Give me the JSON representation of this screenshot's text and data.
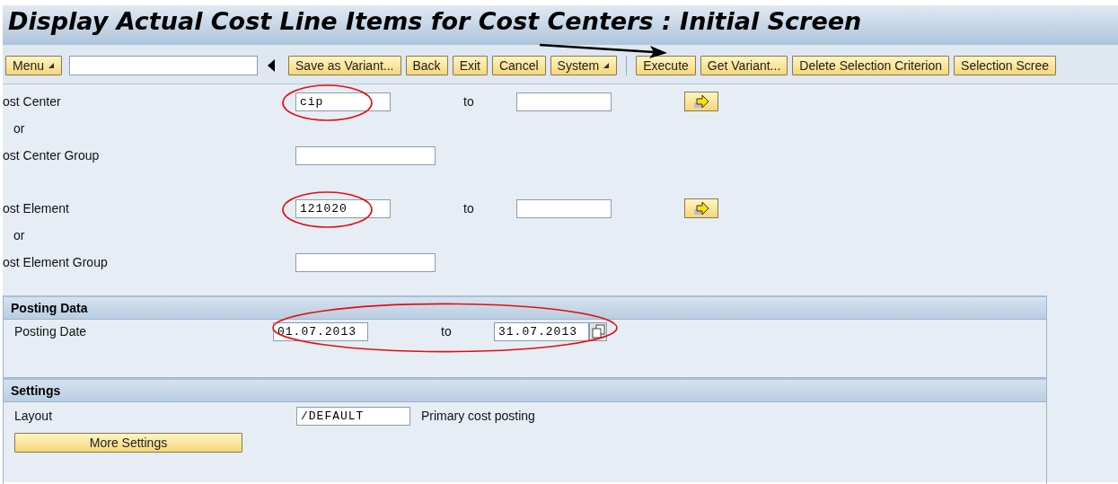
{
  "window": {
    "title": "Display Actual Cost Line Items for Cost Centers : Initial Screen"
  },
  "toolbar": {
    "items": [
      {
        "kind": "dropdown",
        "label": "Menu"
      },
      {
        "kind": "command-field"
      },
      {
        "kind": "back-arrow"
      },
      {
        "kind": "button",
        "label": "Save as Variant..."
      },
      {
        "kind": "button",
        "label": "Back"
      },
      {
        "kind": "button",
        "label": "Exit"
      },
      {
        "kind": "button",
        "label": "Cancel"
      },
      {
        "kind": "dropdown",
        "label": "System"
      },
      {
        "kind": "separator"
      },
      {
        "kind": "button",
        "label": "Execute",
        "pointed_at": true
      },
      {
        "kind": "button",
        "label": "Get Variant..."
      },
      {
        "kind": "button",
        "label": "Delete Selection Criterion"
      },
      {
        "kind": "button",
        "label": "Selection Scree"
      }
    ]
  },
  "selection_groups": [
    [
      {
        "kind": "range",
        "label": "ost Center",
        "low": "cip",
        "to": "to",
        "circled": true
      },
      {
        "kind": "or",
        "label": "or"
      },
      {
        "kind": "single",
        "label": "ost Center Group"
      }
    ],
    [
      {
        "kind": "range",
        "label": "ost Element",
        "low": "121020",
        "to": "to",
        "circled": true
      },
      {
        "kind": "or",
        "label": "or"
      },
      {
        "kind": "single",
        "label": "ost Element Group"
      }
    ]
  ],
  "sections": [
    {
      "title": "Posting Data",
      "rows": [
        {
          "kind": "date-range",
          "label": "Posting Date",
          "low": "01.07.2013",
          "to": "to",
          "high": "31.07.2013",
          "circled": true
        }
      ]
    },
    {
      "title": "Settings",
      "rows": [
        {
          "kind": "single",
          "label": "Layout",
          "value": "/DEFAULT",
          "note": "Primary cost posting"
        },
        {
          "kind": "wide-button",
          "label": "More Settings"
        }
      ]
    }
  ]
}
